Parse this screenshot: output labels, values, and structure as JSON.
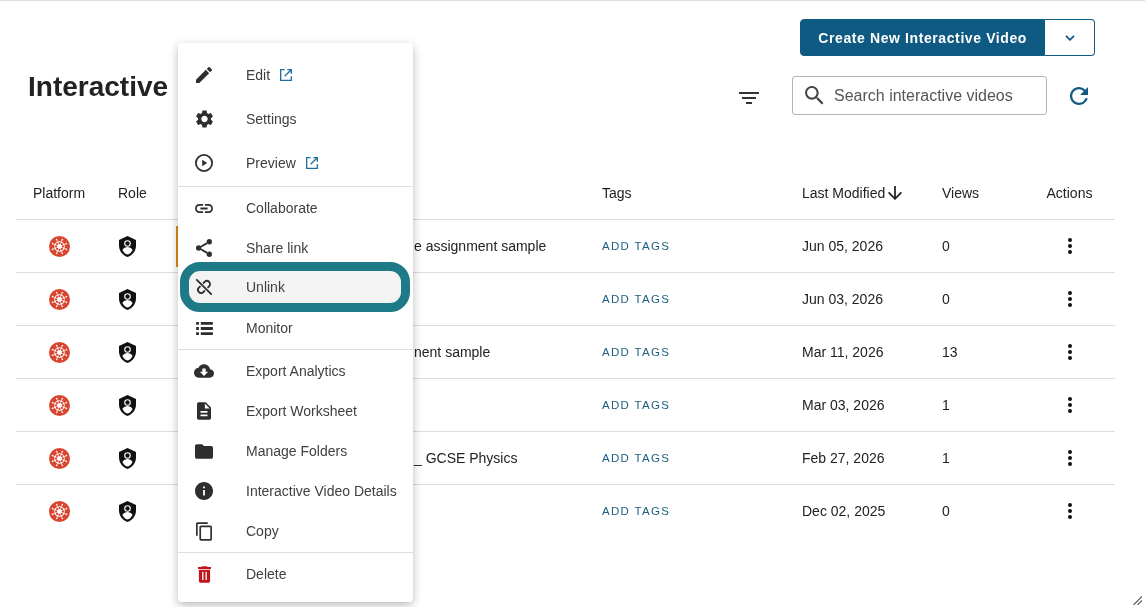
{
  "header": {
    "title": "Interactive",
    "create_button": "Create New Interactive Video",
    "search": {
      "placeholder": "Search interactive videos"
    }
  },
  "table": {
    "columns": [
      {
        "label": "Platform",
        "sorted": false
      },
      {
        "label": "Role",
        "sorted": false
      },
      {
        "label": "Tags",
        "sorted": false
      },
      {
        "label": "Last Modified",
        "sorted": true
      },
      {
        "label": "Views",
        "sorted": false
      },
      {
        "label": "Actions",
        "sorted": false
      }
    ],
    "rows": [
      {
        "selected": true,
        "column_3": "e assignment sample",
        "tags": "ADD TAGS",
        "last_modified": "Jun 05, 2026",
        "views": "0"
      },
      {
        "selected": false,
        "tags": "ADD TAGS",
        "last_modified": "Jun 03, 2026",
        "views": "0"
      },
      {
        "selected": false,
        "column_3": "nent sample",
        "tags": "ADD TAGS",
        "last_modified": "Mar 11, 2026",
        "views": "13"
      },
      {
        "selected": false,
        "tags": "ADD TAGS",
        "last_modified": "Mar 03, 2026",
        "views": "1"
      },
      {
        "selected": false,
        "column_3": "_ GCSE Physics",
        "tags": "ADD TAGS",
        "last_modified": "Feb 27, 2026",
        "views": "1"
      },
      {
        "selected": false,
        "tags": "ADD TAGS",
        "last_modified": "Dec 02, 2025",
        "views": "0"
      }
    ]
  },
  "menu": {
    "groups": [
      {
        "items": [
          {
            "kind": "edit",
            "label": "Edit",
            "external": true,
            "focused": false
          },
          {
            "kind": "settings",
            "label": "Settings",
            "external": false,
            "focused": false
          },
          {
            "kind": "preview",
            "label": "Preview",
            "external": true,
            "focused": false
          }
        ]
      },
      {
        "items": [
          {
            "kind": "collaborate",
            "label": "Collaborate",
            "external": false,
            "focused": false
          },
          {
            "kind": "share",
            "label": "Share link",
            "external": false,
            "focused": false
          },
          {
            "kind": "unlink",
            "label": "Unlink",
            "external": false,
            "focused": true
          },
          {
            "kind": "monitor",
            "label": "Monitor",
            "external": false,
            "focused": false
          }
        ]
      },
      {
        "items": [
          {
            "kind": "analytics",
            "label": "Export Analytics",
            "external": false,
            "focused": false
          },
          {
            "kind": "worksheet",
            "label": "Export Worksheet",
            "external": false,
            "focused": false
          },
          {
            "kind": "folders",
            "label": "Manage Folders",
            "external": false,
            "focused": false
          },
          {
            "kind": "details",
            "label": "Interactive Video Details",
            "external": false,
            "focused": false
          },
          {
            "kind": "copy",
            "label": "Copy",
            "external": false,
            "focused": false
          }
        ]
      },
      {
        "items": [
          {
            "kind": "delete",
            "label": "Delete",
            "external": false,
            "focused": false
          }
        ]
      }
    ]
  }
}
